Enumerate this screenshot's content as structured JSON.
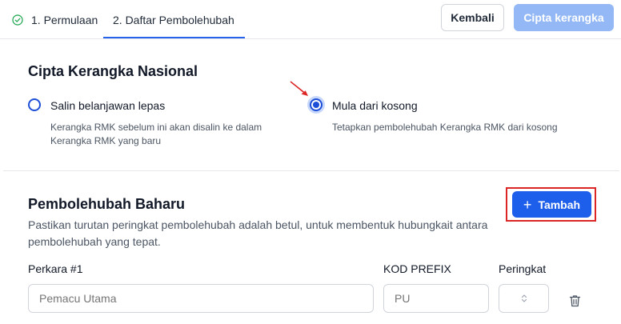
{
  "steps": [
    {
      "label": "1. Permulaan",
      "completed": true
    },
    {
      "label": "2. Daftar Pembolehubah",
      "active": true
    }
  ],
  "header": {
    "back_label": "Kembali",
    "create_label": "Cipta kerangka"
  },
  "national": {
    "title": "Cipta Kerangka Nasional",
    "options": [
      {
        "label": "Salin belanjawan lepas",
        "description": "Kerangka RMK sebelum ini akan disalin ke dalam Kerangka RMK yang baru",
        "selected": false
      },
      {
        "label": "Mula dari kosong",
        "description": "Tetapkan pembolehubah Kerangka RMK dari kosong",
        "selected": true
      }
    ]
  },
  "variables": {
    "title": "Pembolehubah Baharu",
    "description": "Pastikan turutan peringkat pembolehubah adalah betul, untuk membentuk hubungkait antara pembolehubah yang tepat.",
    "add_label": "Tambah",
    "item_label": "Perkara #1",
    "kod_label": "KOD PREFIX",
    "rank_label": "Peringkat",
    "item_placeholder": "Pemacu Utama",
    "kod_placeholder": "PU"
  },
  "colors": {
    "accent": "#1d5eea",
    "accent_disabled": "#93b8f5",
    "annotation": "#dc2626"
  },
  "icons": [
    "check-circle-icon",
    "plus-icon",
    "chevron-updown-icon",
    "trash-icon",
    "annotation-arrow-icon"
  ]
}
